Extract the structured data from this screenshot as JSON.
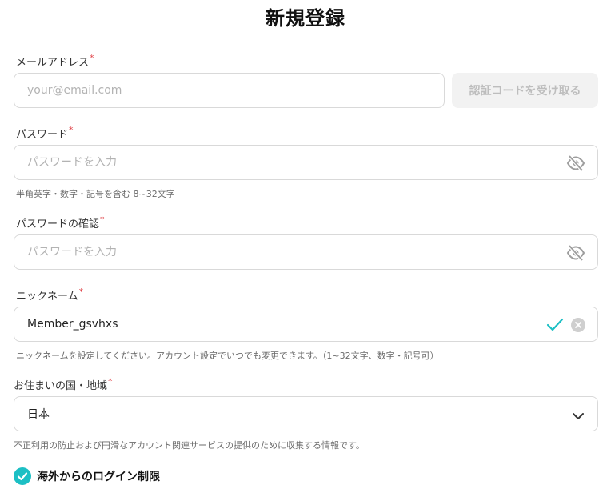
{
  "title": "新規登録",
  "email": {
    "label": "メールアドレス",
    "required_mark": "*",
    "placeholder": "your@email.com",
    "value": "",
    "code_button_label": "認証コードを受け取る"
  },
  "password": {
    "label": "パスワード",
    "required_mark": "*",
    "placeholder": "パスワードを入力",
    "value": "",
    "hint": "半角英字・数字・記号を含む 8~32文字",
    "toggle_icon": "eye-off-icon"
  },
  "password_confirm": {
    "label": "パスワードの確認",
    "required_mark": "*",
    "placeholder": "パスワードを入力",
    "value": "",
    "toggle_icon": "eye-off-icon"
  },
  "nickname": {
    "label": "ニックネーム",
    "required_mark": "*",
    "value": "Member_gsvhxs",
    "hint": "ニックネームを設定してください。アカウント設定でいつでも変更できます。（1~32文字、数字・記号可）",
    "valid_icon": "check-icon",
    "clear_icon": "clear-icon"
  },
  "country": {
    "label": "お住まいの国・地域",
    "required_mark": "*",
    "selected": "日本",
    "hint": "不正利用の防止および円滑なアカウント関連サービスの提供のために収集する情報です。"
  },
  "overseas_login": {
    "label": "海外からのログイン制限",
    "checked": true
  },
  "colors": {
    "accent": "#1cbfc4",
    "required": "#e0454a",
    "border": "#d9d9d9",
    "disabled_button_bg": "#f2f2f2",
    "disabled_button_text": "#bdbdbd"
  }
}
